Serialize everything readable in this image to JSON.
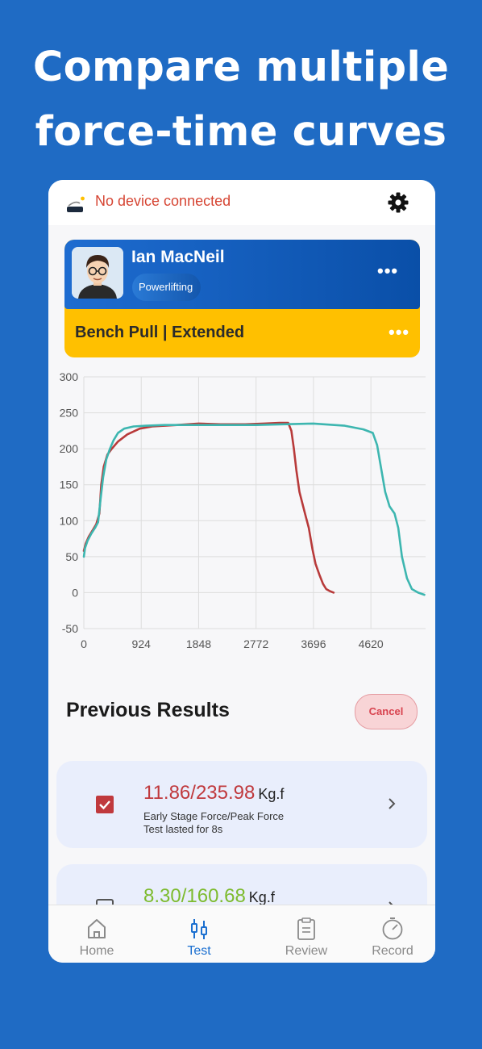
{
  "headline": {
    "line1": "Compare multiple",
    "line2": "force-time curves"
  },
  "status": {
    "device_text": "No device connected",
    "device_color": "#d64533"
  },
  "profile": {
    "name": "Ian MacNeil",
    "sport": "Powerlifting",
    "exercise": "Bench Pull | Extended",
    "menu_label": "•••",
    "primary_color": "#1e6cd0",
    "exercise_color": "#ffc000"
  },
  "chart_data": {
    "type": "line",
    "title": "",
    "xlabel": "",
    "ylabel": "",
    "x_ticks": [
      "0",
      "924",
      "1848",
      "2772",
      "3696",
      "4620"
    ],
    "y_ticks": [
      "300",
      "250",
      "200",
      "150",
      "100",
      "50",
      "0",
      "-50"
    ],
    "xlim": [
      0,
      5500
    ],
    "ylim": [
      -50,
      300
    ],
    "grid": true,
    "series": [
      {
        "color": "#b83a3a",
        "x": [
          0,
          30,
          80,
          150,
          200,
          250,
          280,
          320,
          380,
          450,
          550,
          700,
          900,
          1100,
          1300,
          1500,
          1848,
          2200,
          2600,
          2900,
          3150,
          3290,
          3340,
          3380,
          3420,
          3470,
          3530,
          3560,
          3620,
          3680,
          3730,
          3790,
          3850,
          3900,
          3960,
          4020
        ],
        "y": [
          58,
          68,
          78,
          88,
          95,
          110,
          150,
          175,
          192,
          200,
          210,
          220,
          228,
          231,
          232,
          233,
          235,
          234,
          234,
          235,
          236,
          236,
          225,
          200,
          170,
          140,
          120,
          110,
          90,
          60,
          40,
          25,
          12,
          5,
          2,
          0
        ]
      },
      {
        "color": "#3db6b0",
        "x": [
          0,
          20,
          60,
          120,
          180,
          230,
          270,
          310,
          360,
          420,
          480,
          550,
          650,
          800,
          1000,
          1300,
          1848,
          2400,
          2772,
          3200,
          3696,
          4200,
          4500,
          4650,
          4720,
          4780,
          4850,
          4920,
          5000,
          5060,
          5120,
          5200,
          5280,
          5380,
          5480
        ],
        "y": [
          50,
          62,
          72,
          82,
          90,
          98,
          130,
          160,
          185,
          200,
          212,
          222,
          228,
          231,
          232,
          233,
          233,
          233,
          233,
          234,
          235,
          232,
          227,
          222,
          205,
          175,
          140,
          120,
          110,
          90,
          50,
          20,
          5,
          0,
          -3
        ]
      }
    ]
  },
  "results": {
    "title": "Previous Results",
    "cancel_label": "Cancel",
    "items": [
      {
        "checked": true,
        "score": "11.86/235.98",
        "unit": "Kg.f",
        "line1": "Early Stage Force/Peak Force",
        "line2": "Test lasted for 8s",
        "color": "#c0393d"
      },
      {
        "checked": false,
        "score": "8.30/160.68",
        "unit": "Kg.f",
        "color": "#7dbb2e"
      }
    ]
  },
  "tabs": [
    {
      "label": "Home",
      "icon": "home-icon",
      "active": false
    },
    {
      "label": "Test",
      "icon": "test-icon",
      "active": true
    },
    {
      "label": "Review",
      "icon": "clipboard-icon",
      "active": false
    },
    {
      "label": "Record",
      "icon": "timer-icon",
      "active": false
    }
  ],
  "active_color": "#1a6fd0"
}
